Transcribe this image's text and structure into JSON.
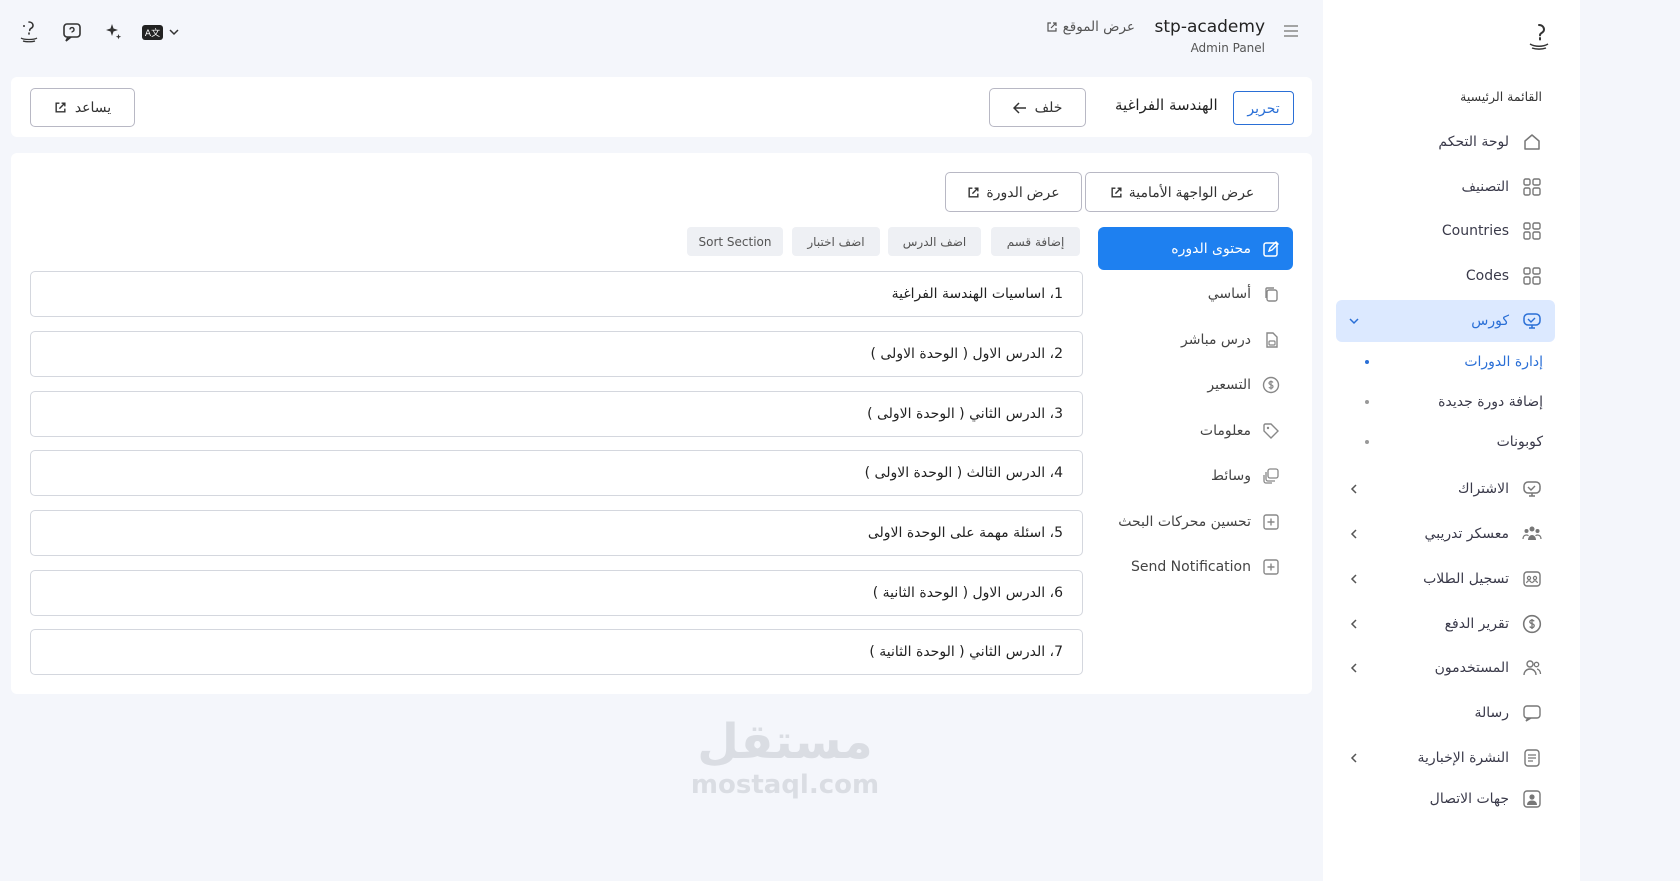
{
  "topbar": {
    "brand_name": "stp-academy",
    "brand_sub": "Admin Panel",
    "view_site": "عرض الموقع",
    "lang_badge": "A文"
  },
  "sidebar": {
    "section_title": "القائمة الرئيسية",
    "items": [
      {
        "label": "لوحة التحكم",
        "icon": "home-icon"
      },
      {
        "label": "التصنيف",
        "icon": "grid-icon"
      },
      {
        "label": "Countries",
        "icon": "grid-icon"
      },
      {
        "label": "Codes",
        "icon": "grid-icon"
      },
      {
        "label": "كورس",
        "icon": "monitor-icon"
      },
      {
        "label": "الاشتراك",
        "icon": "monitor-icon"
      },
      {
        "label": "معسكر تدريبي",
        "icon": "group-icon"
      },
      {
        "label": "تسجيل الطلاب",
        "icon": "students-icon"
      },
      {
        "label": "تقرير الدفع",
        "icon": "dollar-icon"
      },
      {
        "label": "المستخدمون",
        "icon": "users-icon"
      },
      {
        "label": "رسالة",
        "icon": "chat-icon"
      },
      {
        "label": "النشرة الإخبارية",
        "icon": "newsletter-icon"
      },
      {
        "label": "جهات الاتصال",
        "icon": "contact-icon"
      }
    ],
    "subitems": [
      {
        "label": "إدارة الدورات"
      },
      {
        "label": "إضافة دورة جديدة"
      },
      {
        "label": "كوبونات"
      }
    ]
  },
  "header": {
    "edit_label": "تحرير",
    "title": "الهندسة الفراغية",
    "back_label": "خلف",
    "help_label": "يساعد"
  },
  "main": {
    "front_view_label": "عرض الواجهة الأمامية",
    "course_view_label": "عرض الدورة",
    "tabs": [
      {
        "label": "محتوى الدوره",
        "icon": "edit-icon"
      },
      {
        "label": "أساسي",
        "icon": "copy-icon"
      },
      {
        "label": "درس مباشر",
        "icon": "file-icon"
      },
      {
        "label": "التسعير",
        "icon": "dollar-icon"
      },
      {
        "label": "معلومات",
        "icon": "tag-icon"
      },
      {
        "label": "وسائط",
        "icon": "media-icon"
      },
      {
        "label": "تحسين محركات البحث",
        "icon": "plus-square-icon"
      },
      {
        "label": "Send Notification",
        "icon": "plus-square-icon"
      }
    ],
    "actions": {
      "add_section": "إضافة قسم",
      "add_lesson": "اضف الدرس",
      "add_quiz": "اضف اختبار",
      "sort_section": "Sort Section"
    },
    "sections": [
      "1، اساسيات الهندسة الفراغية",
      "2، الدرس الاول ( الوحدة الاولى )",
      "3، الدرس الثاني ( الوحدة الاولى )",
      "4، الدرس الثالث ( الوحدة الاولى )",
      "5، اسئلة مهمة على الوحدة الاولى",
      "6، الدرس الاول ( الوحدة الثانية )",
      "7، الدرس الثاني ( الوحدة الثانية )"
    ]
  },
  "watermark": {
    "arabic": "مستقل",
    "latin": "mostaql.com"
  },
  "colors": {
    "accent": "#1e80f0",
    "active_bg": "#dce9ff",
    "link_blue": "#2a6fd6"
  }
}
